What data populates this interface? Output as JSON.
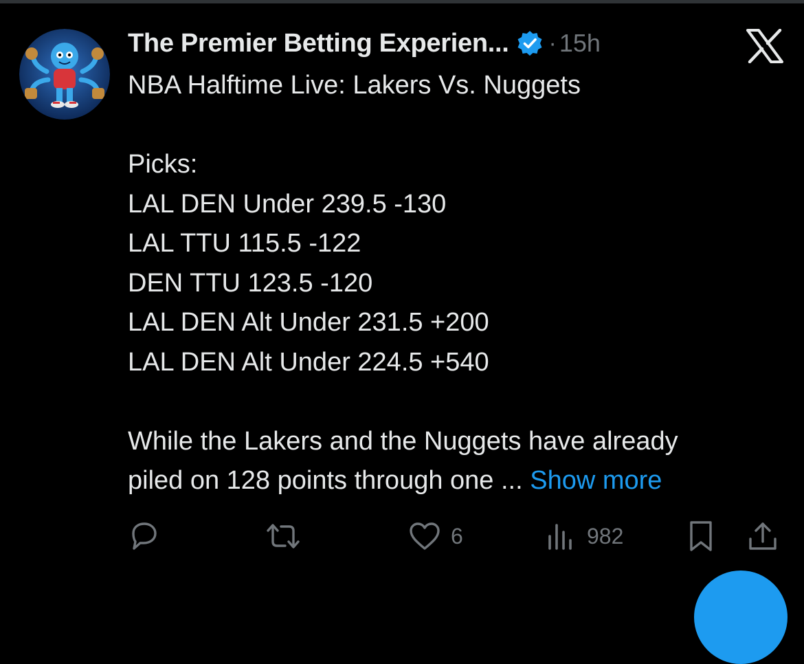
{
  "author": {
    "display_name": "The Premier Betting Experien...",
    "timestamp": "15h",
    "separator": "·",
    "verified": true,
    "avatar_icon": "avatar-image"
  },
  "platform_icon": "x-logo-icon",
  "tweet": {
    "title": "NBA Halftime Live: Lakers Vs. Nuggets",
    "picks_label": "Picks:",
    "picks": [
      "LAL DEN Under 239.5 -130",
      "LAL TTU 115.5 -122",
      "DEN TTU 123.5 -120",
      "LAL DEN Alt Under 231.5 +200",
      "LAL DEN Alt Under 224.5 +540"
    ],
    "body_line1": "While the Lakers and the Nuggets have already",
    "body_line2": "piled on 128 points through one ...",
    "show_more": "Show more"
  },
  "actions": {
    "reply_count": "",
    "retweet_count": "",
    "like_count": "6",
    "views_count": "982"
  },
  "colors": {
    "background": "#000000",
    "text": "#e7e9ea",
    "muted": "#71767b",
    "accent": "#1d9bf0"
  }
}
